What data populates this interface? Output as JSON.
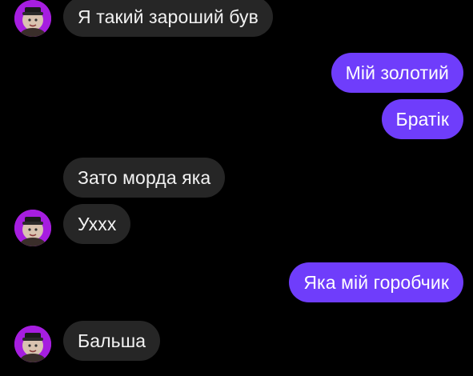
{
  "colors": {
    "background": "#000000",
    "incoming_bubble": "#262626",
    "outgoing_bubble": "#6f3dfb",
    "avatar_bg": "#a61ee0"
  },
  "messages": [
    {
      "direction": "incoming",
      "text": "Я такий зароший був",
      "avatar": "contact-avatar"
    },
    {
      "direction": "outgoing",
      "text": "Мій золотий"
    },
    {
      "direction": "outgoing",
      "text": "Братік"
    },
    {
      "direction": "incoming",
      "text": "Зато морда яка"
    },
    {
      "direction": "incoming",
      "text": "Ухxx",
      "avatar": "contact-avatar"
    },
    {
      "direction": "outgoing",
      "text": "Яка мій горобчик"
    },
    {
      "direction": "incoming",
      "text": "Бальша",
      "avatar": "contact-avatar"
    }
  ]
}
